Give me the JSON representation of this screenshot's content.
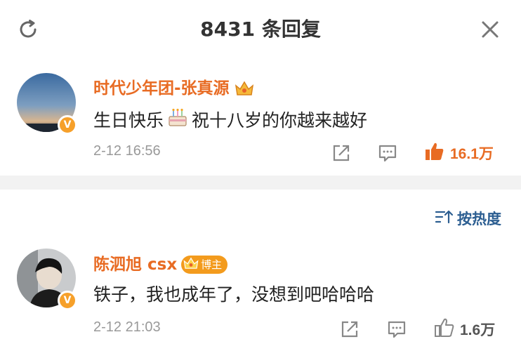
{
  "header": {
    "title": "8431 条回复",
    "refresh_icon": "refresh-icon",
    "close_icon": "close-icon"
  },
  "comments": [
    {
      "username": "时代少年团-张真源",
      "badge": "crown-icon",
      "text_before": "生日快乐",
      "emoji": "cake-icon",
      "text_after": "祝十八岁的你越来越好",
      "time": "2-12 16:56",
      "likes": "16.1万",
      "liked": true
    },
    {
      "username": "陈泗旭 csx",
      "badge": "crown-icon",
      "host_label": "博主",
      "text": "铁子，我也成年了，没想到吧哈哈哈",
      "time": "2-12 21:03",
      "likes": "1.6万",
      "liked": false
    }
  ],
  "sort": {
    "label": "按热度"
  },
  "colors": {
    "username": "#e86b23",
    "liked": "#e86b23",
    "sort": "#2c5e91",
    "muted": "#999999"
  }
}
